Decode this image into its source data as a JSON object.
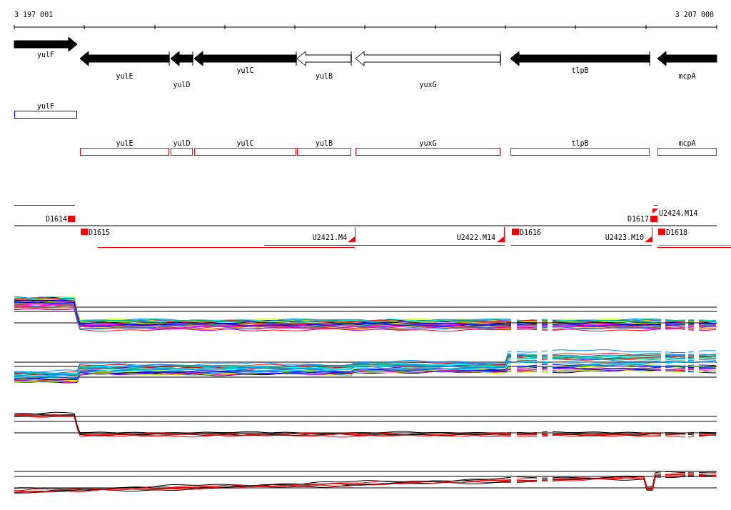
{
  "ruler": {
    "start_label": "3 197 001",
    "end_label": "3 207 000"
  },
  "genes": [
    {
      "name": "yulF",
      "reverse": false,
      "filled": true
    },
    {
      "name": "yulE",
      "reverse": true,
      "filled": true
    },
    {
      "name": "yulD",
      "reverse": true,
      "filled": true
    },
    {
      "name": "yulC",
      "reverse": true,
      "filled": true
    },
    {
      "name": "yulB",
      "reverse": true,
      "filled": false
    },
    {
      "name": "yuxG",
      "reverse": true,
      "filled": false
    },
    {
      "name": "tlpB",
      "reverse": true,
      "filled": true
    },
    {
      "name": "mcpA",
      "reverse": true,
      "filled": true
    }
  ],
  "gene_boxes": [
    {
      "name": "yulF",
      "color": "#0000ff"
    },
    {
      "name": "yulE",
      "color": "#ff0000"
    },
    {
      "name": "yulD",
      "color": "#ff0000"
    },
    {
      "name": "yulC",
      "color": "#ff0000"
    },
    {
      "name": "yulB",
      "color": "#ff0000"
    },
    {
      "name": "yuxG",
      "color": "#ff0000"
    },
    {
      "name": "tlpB",
      "color": "#ff0000"
    },
    {
      "name": "mcpA",
      "color": "#ff0000"
    }
  ],
  "spans": [
    {
      "color": "#ff0000"
    },
    {
      "color": "#ff0000"
    },
    {
      "color": "#ff0000"
    },
    {
      "color": "#ff0000"
    },
    {
      "color": "#00ff00"
    },
    {
      "color": "#ff0000"
    },
    {
      "color": "#ff0000"
    }
  ],
  "markers": [
    {
      "label": "D1614",
      "kind": "block"
    },
    {
      "label": "D1615",
      "kind": "block"
    },
    {
      "label": "U2421.M4",
      "kind": "triangle"
    },
    {
      "label": "U2422.M14",
      "kind": "triangle"
    },
    {
      "label": "D1616",
      "kind": "block"
    },
    {
      "label": "D1617",
      "kind": "block"
    },
    {
      "label": "U2424.M14",
      "kind": "flag"
    },
    {
      "label": "U2423.M10",
      "kind": "triangle"
    },
    {
      "label": "D1618",
      "kind": "block"
    }
  ],
  "expression_panels": [
    {
      "kind": "multi"
    },
    {
      "kind": "multi"
    },
    {
      "kind": "pair"
    },
    {
      "kind": "pair"
    }
  ]
}
